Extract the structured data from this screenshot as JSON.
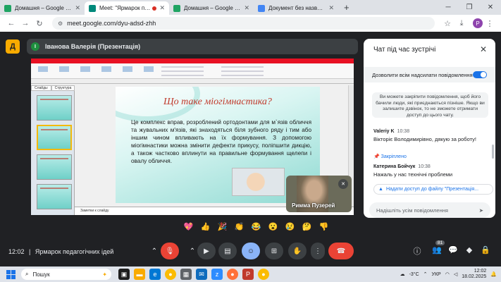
{
  "browser": {
    "tabs": [
      {
        "title": "Домашня – Google Диск",
        "favicon_color": "#1fa463",
        "active": false
      },
      {
        "title": "Meet: \"Ярмарок педагогі",
        "favicon_color": "#00897b",
        "active": true,
        "recording": true
      },
      {
        "title": "Домашня – Google Диск",
        "favicon_color": "#1fa463",
        "active": false
      },
      {
        "title": "Документ без назви - Google",
        "favicon_color": "#4285f4",
        "active": false
      }
    ],
    "url": "meet.google.com/dyu-adsd-zhh",
    "profile_initial": "P"
  },
  "meeting": {
    "logo_letter": "Д",
    "presenter_initial": "I",
    "presenter_label": "Іванова Валерія (Презентація)",
    "time": "12:02",
    "title": "Ярмарок педагогічних ідей"
  },
  "slide": {
    "title": "Що таке міогімнастика?",
    "body": "Це комплекс вправ, розроблений ортодонтами для м`язів обличчя та жувальних м'язів, які знаходяться біля зубного ряду і тим або іншим чином впливають на їх формування. З допомогою міогімнастики можна змінити дефекти прикусу, поліпшити дикцію, а також частково вплинути на правильне формування щелепи і овалу обличчя.",
    "notes_placeholder": "Заметки к слайду",
    "tabs": [
      "Слайды",
      "Структура"
    ]
  },
  "participant": {
    "name": "Римма Пузерей"
  },
  "reactions": [
    "💖",
    "👍",
    "🎉",
    "👏",
    "😂",
    "😮",
    "😢",
    "🤔",
    "👎"
  ],
  "controls": {
    "participants_badge": "81"
  },
  "chat": {
    "title": "Чат під час зустрічі",
    "allow_label": "Дозволити всім надсилати повідомлення",
    "notice": "Ви можете закріпити повідомлення, щоб його бачили люди, які приєднаються пізніше. Якщо ви залишите дзвінок, то не зможете отримати доступ до цього чату.",
    "messages": [
      {
        "author": "Valeriy K",
        "time": "10:38",
        "text": "Вікторіє Володимирівно, дякую за роботу!",
        "pinned": "Закріплено"
      },
      {
        "author": "Катерина Бойчук",
        "time": "10:38",
        "text": "Нажаль у нас технічні проблеми"
      }
    ],
    "file_chip": "Надати доступ до файлу \"Презентація...",
    "input_placeholder": "Надішліть усім повідомлення"
  },
  "taskbar": {
    "search_placeholder": "Пошук",
    "temperature": "-3°C",
    "language": "УКР",
    "time": "12:02",
    "date": "18.02.2025"
  }
}
